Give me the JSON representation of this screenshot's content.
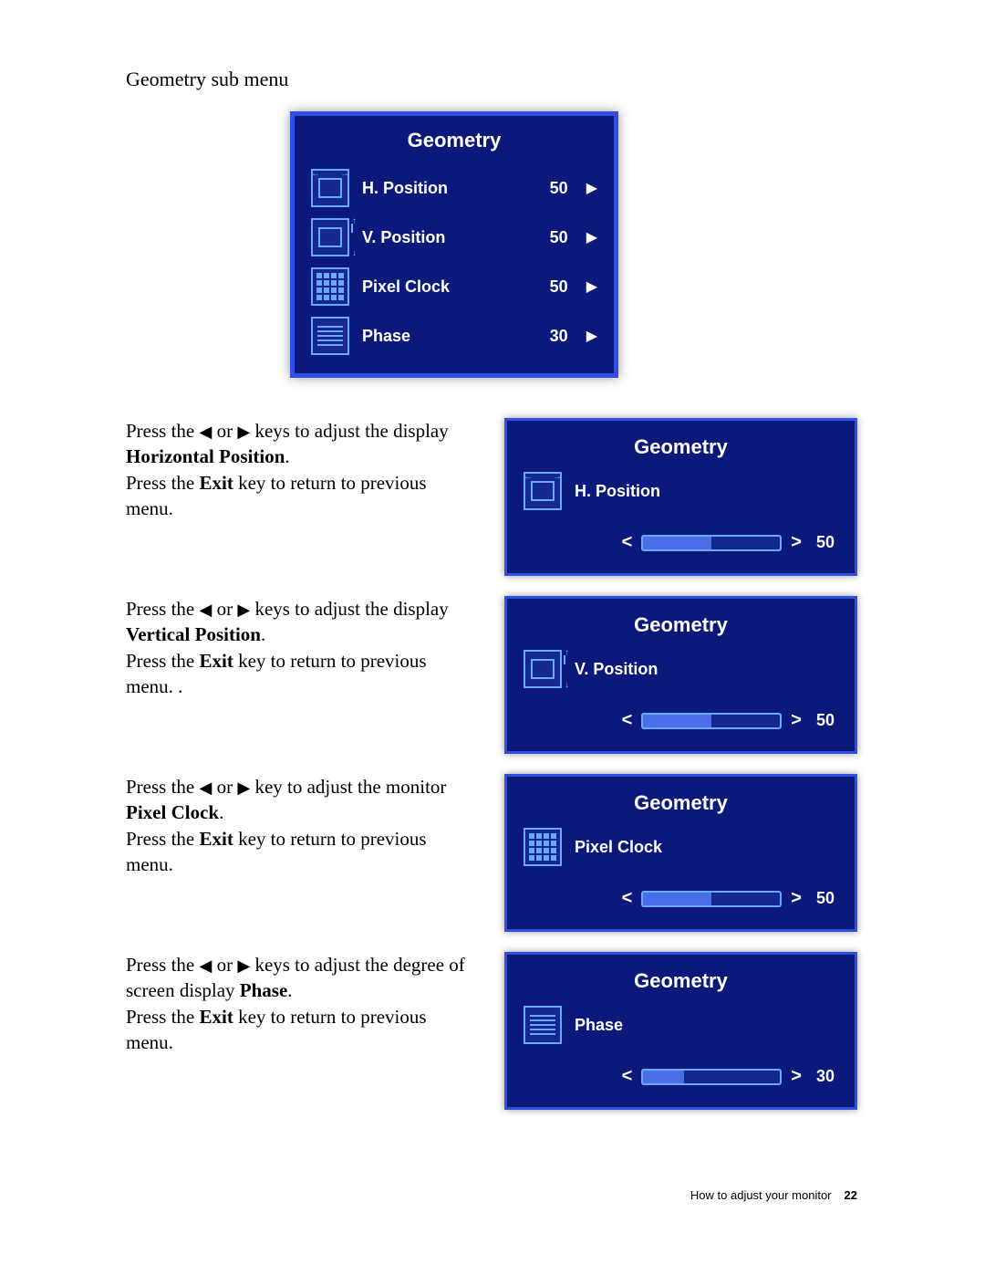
{
  "heading": "Geometry sub menu",
  "osd": {
    "title": "Geometry",
    "rows": [
      {
        "icon": "hposition-icon",
        "label": "H. Position",
        "value": "50"
      },
      {
        "icon": "vposition-icon",
        "label": "V. Position",
        "value": "50"
      },
      {
        "icon": "pixelclock-icon",
        "label": "Pixel Clock",
        "value": "50"
      },
      {
        "icon": "phase-icon",
        "label": "Phase",
        "value": "30"
      }
    ]
  },
  "sections": [
    {
      "line1a": "Press the ",
      "line1b": " or ",
      "line1c": " keys to adjust the display ",
      "param": "Horizontal Position",
      "period": ".",
      "exit": "Press the ",
      "exit_bold": "Exit",
      "exit2": " key to return to previous menu.",
      "extra": "",
      "panel_title": "Geometry",
      "panel_label": "H. Position",
      "panel_value": "50",
      "panel_fill_pct": 50,
      "panel_icon": "hposition-icon"
    },
    {
      "line1a": "Press the ",
      "line1b": " or ",
      "line1c": " keys to adjust the display ",
      "param": "Vertical Position",
      "period": ".",
      "exit": "Press the ",
      "exit_bold": "Exit",
      "exit2": " key to return to previous menu. .",
      "extra": "",
      "panel_title": "Geometry",
      "panel_label": "V. Position",
      "panel_value": "50",
      "panel_fill_pct": 50,
      "panel_icon": "vposition-icon"
    },
    {
      "line1a": "Press the ",
      "line1b": " or ",
      "line1c": " key to adjust the monitor ",
      "param": "Pixel Clock",
      "period": ".",
      "exit": "Press the ",
      "exit_bold": "Exit",
      "exit2": " key to return to previous menu.",
      "extra": "",
      "panel_title": "Geometry",
      "panel_label": "Pixel Clock",
      "panel_value": "50",
      "panel_fill_pct": 50,
      "panel_icon": "pixelclock-icon"
    },
    {
      "line1a": "Press the ",
      "line1b": " or ",
      "line1c": " keys to adjust the degree of screen display ",
      "param": "Phase",
      "period": ".",
      "exit": "Press the ",
      "exit_bold": "Exit",
      "exit2": " key to return to previous menu.",
      "extra": "",
      "panel_title": "Geometry",
      "panel_label": "Phase",
      "panel_value": "30",
      "panel_fill_pct": 30,
      "panel_icon": "phase-icon"
    }
  ],
  "triangles": {
    "left": "◀",
    "right": "▶",
    "chev_left": "<",
    "chev_right": ">"
  },
  "footer": {
    "text": "How to adjust your monitor",
    "page": "22"
  }
}
